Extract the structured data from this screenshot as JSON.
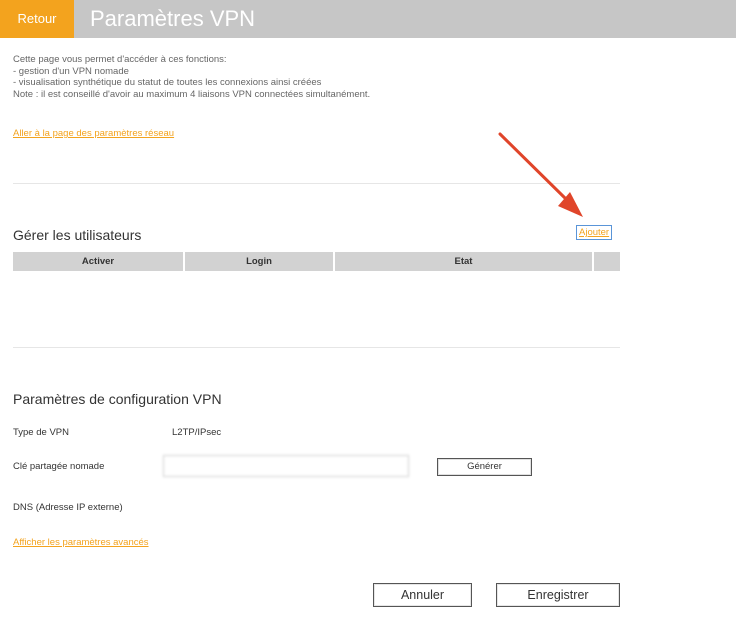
{
  "header": {
    "back_label": "Retour",
    "title": "Paramètres VPN"
  },
  "intro": {
    "lines": [
      "Cette page vous permet d'accéder à ces fonctions:",
      "- gestion d'un VPN nomade",
      "- visualisation synthétique du statut de toutes les connexions ainsi créées",
      "Note : il est conseillé d'avoir au maximum 4 liaisons VPN connectées simultanément."
    ],
    "network_link": "Aller à la page des paramètres réseau"
  },
  "users": {
    "title": "Gérer les utilisateurs",
    "add_link": "Ajouter",
    "columns": [
      "Activer",
      "Login",
      "Etat",
      ""
    ],
    "rows": []
  },
  "vpn_config": {
    "title": "Paramètres de configuration VPN",
    "type_label": "Type de VPN",
    "type_value": "L2TP/IPsec",
    "psk_label": "Clé partagée nomade",
    "psk_value": "",
    "generate_button": "Générer",
    "dns_label": "DNS (Adresse IP externe)",
    "dns_value": "",
    "advanced_link": "Afficher les paramètres avancés"
  },
  "footer": {
    "cancel_button": "Annuler",
    "save_button": "Enregistrer"
  },
  "colors": {
    "accent": "#f3a31e",
    "header_bg": "#c6c6c6",
    "table_header_bg": "#d2d2d2",
    "annotation_arrow": "#e0452a"
  }
}
